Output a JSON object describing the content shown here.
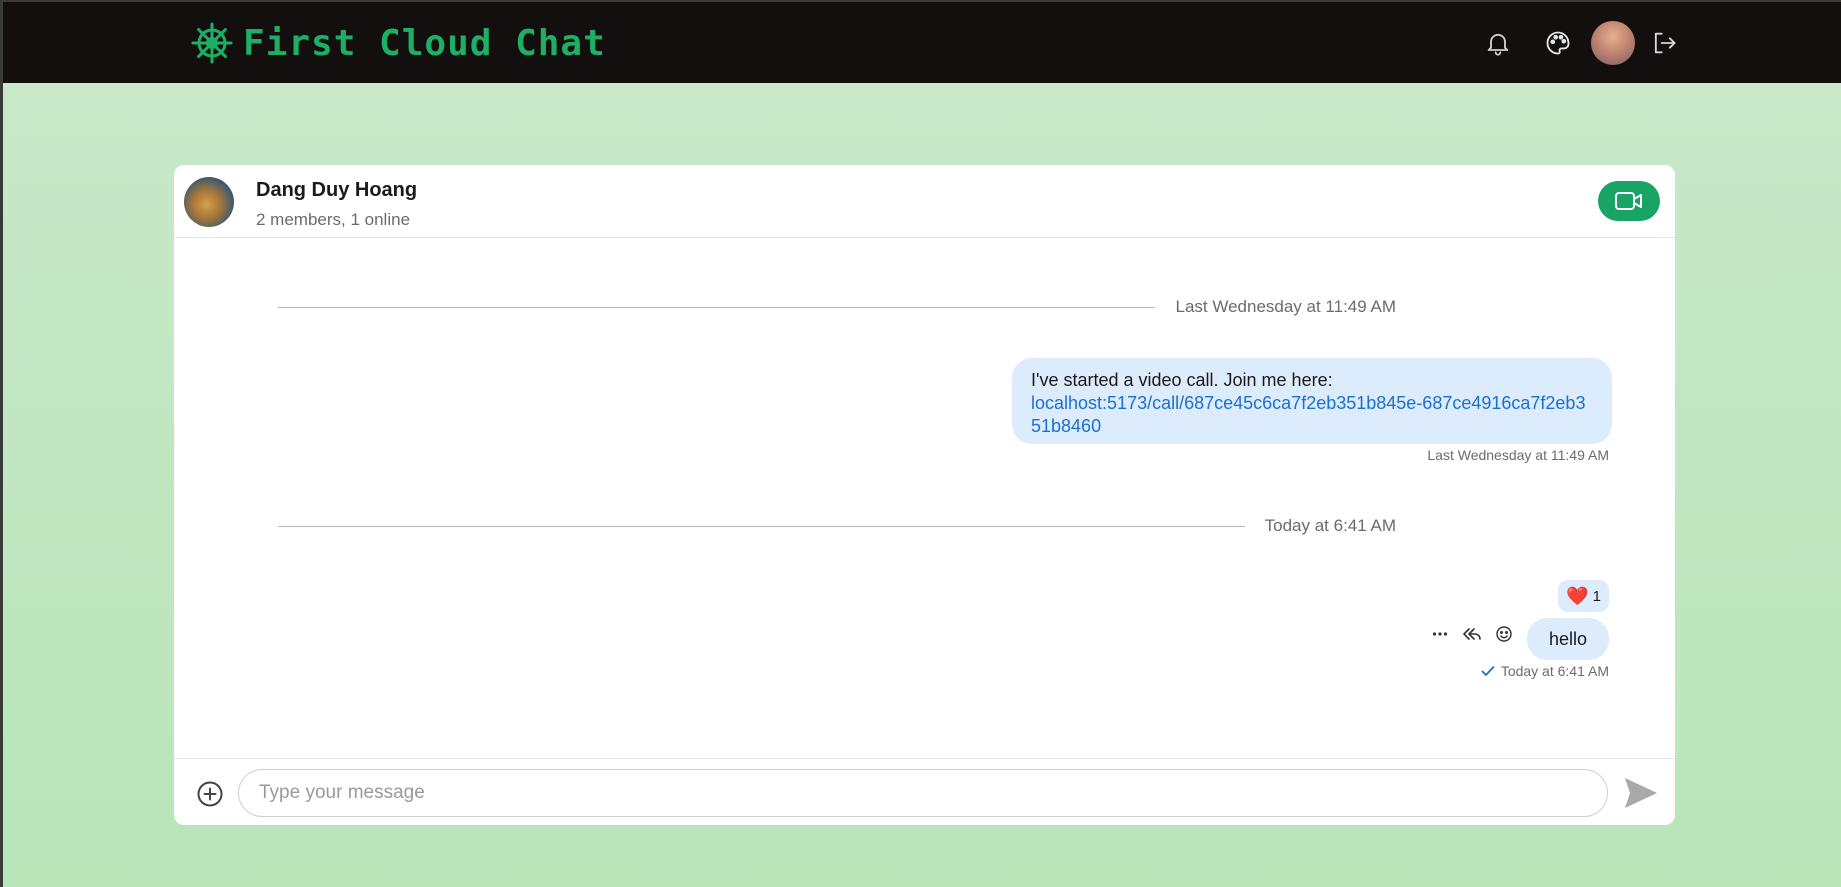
{
  "app": {
    "title": "First Cloud Chat",
    "brand_icon": "ship-wheel-icon",
    "brand_color": "#1db065"
  },
  "topbar": {
    "icons": [
      "bell-icon",
      "palette-icon",
      "user-avatar",
      "logout-icon"
    ]
  },
  "conversation": {
    "name": "Dang Duy Hoang",
    "subtitle": "2 members, 1 online",
    "video_button_icon": "video-camera-icon",
    "accent_color": "#19a364"
  },
  "messages": {
    "divider_1": "Last Wednesday at 11:49 AM",
    "msg_1": {
      "text": "I've started a video call. Join me here:",
      "link": "localhost:5173/call/687ce45c6ca7f2eb351b845e-687ce4916ca7f2eb351b8460",
      "timestamp": "Last Wednesday at 11:49 AM"
    },
    "divider_2": "Today at 6:41 AM",
    "msg_2": {
      "text": "hello",
      "reaction_emoji": "❤️",
      "reaction_count": "1",
      "timestamp": "Today at 6:41 AM",
      "status": "sent"
    },
    "bubble_color": "#dcecfc",
    "link_color": "#1b6fd0"
  },
  "composer": {
    "placeholder": "Type your message"
  }
}
